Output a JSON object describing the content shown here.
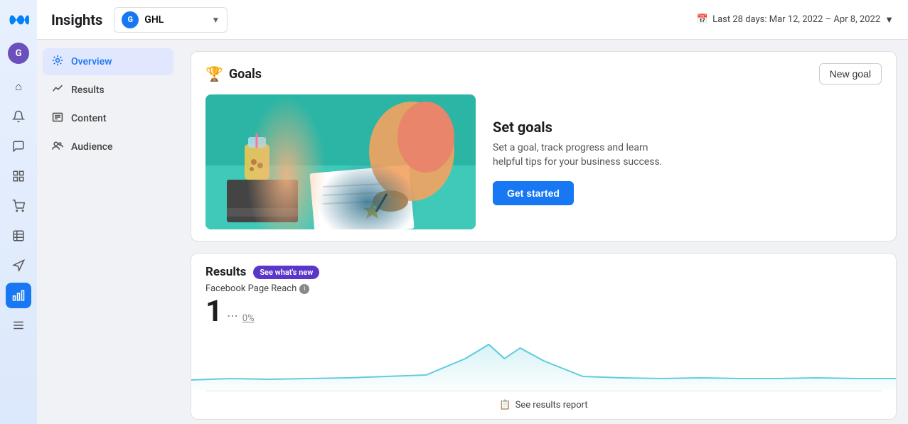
{
  "app": {
    "meta_logo_alt": "Meta",
    "user_initial": "G"
  },
  "header": {
    "title": "Insights",
    "account": {
      "name": "GHL",
      "icon_letter": "G"
    },
    "date_range": "Last 28 days: Mar 12, 2022 – Apr 8, 2022"
  },
  "sidebar": {
    "items": [
      {
        "id": "overview",
        "label": "Overview",
        "icon": "✦",
        "active": true
      },
      {
        "id": "results",
        "label": "Results",
        "icon": "📈",
        "active": false
      },
      {
        "id": "content",
        "label": "Content",
        "icon": "📋",
        "active": false
      },
      {
        "id": "audience",
        "label": "Audience",
        "icon": "👥",
        "active": false
      }
    ]
  },
  "goals_card": {
    "title": "Goals",
    "new_goal_label": "New goal",
    "set_goals_heading": "Set goals",
    "set_goals_desc": "Set a goal, track progress and learn helpful tips for your business success.",
    "get_started_label": "Get started"
  },
  "results_card": {
    "title": "Results",
    "whats_new_label": "See what's new",
    "fb_reach_label": "Facebook Page Reach",
    "reach_value": "1",
    "reach_dots": "···",
    "reach_percent": "0%",
    "see_results_label": "See results report"
  },
  "left_nav_icons": [
    {
      "name": "home",
      "symbol": "⌂",
      "active": false
    },
    {
      "name": "bell",
      "symbol": "🔔",
      "active": false
    },
    {
      "name": "chat",
      "symbol": "💬",
      "active": false
    },
    {
      "name": "pages",
      "symbol": "▤",
      "active": false
    },
    {
      "name": "shop",
      "symbol": "🛒",
      "active": false
    },
    {
      "name": "table",
      "symbol": "⊞",
      "active": false
    },
    {
      "name": "megaphone",
      "symbol": "📢",
      "active": false
    },
    {
      "name": "chart",
      "symbol": "📊",
      "active": true
    },
    {
      "name": "menu",
      "symbol": "≡",
      "active": false
    }
  ],
  "colors": {
    "accent_blue": "#1877f2",
    "chart_line": "#60cddd",
    "chart_fill": "rgba(96,205,221,0.15)",
    "badge_purple": "#5c35c9"
  }
}
